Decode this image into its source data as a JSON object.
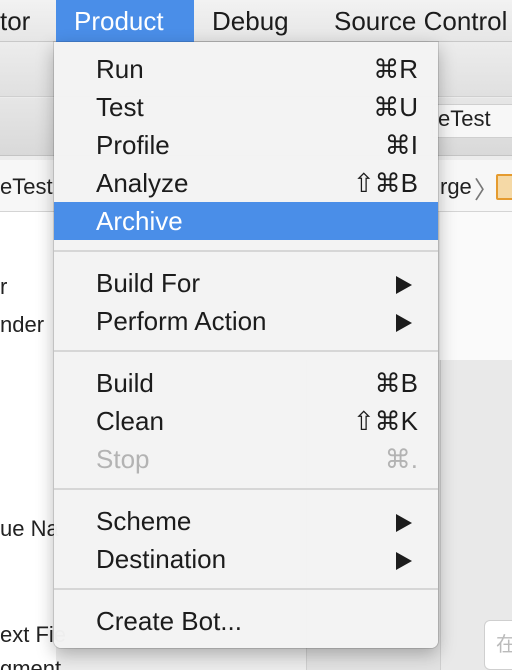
{
  "menubar": {
    "items": [
      {
        "label": "tor"
      },
      {
        "label": "Product"
      },
      {
        "label": "Debug"
      },
      {
        "label": "Source Control"
      }
    ]
  },
  "background": {
    "tab_right": "eTest",
    "jump_left": "eTest",
    "jump_right": "rge",
    "left_lines": [
      "r",
      "nder",
      "ue Na",
      "ext Fie",
      "gment"
    ],
    "right_box": "在"
  },
  "menu": {
    "items": [
      {
        "label": "Run",
        "shortcut": "⌘R"
      },
      {
        "label": "Test",
        "shortcut": "⌘U"
      },
      {
        "label": "Profile",
        "shortcut": "⌘I"
      },
      {
        "label": "Analyze",
        "shortcut": "⇧⌘B"
      },
      {
        "label": "Archive",
        "shortcut": ""
      },
      {
        "label": "Build For",
        "shortcut": ""
      },
      {
        "label": "Perform Action",
        "shortcut": ""
      },
      {
        "label": "Build",
        "shortcut": "⌘B"
      },
      {
        "label": "Clean",
        "shortcut": "⇧⌘K"
      },
      {
        "label": "Stop",
        "shortcut": "⌘."
      },
      {
        "label": "Scheme",
        "shortcut": ""
      },
      {
        "label": "Destination",
        "shortcut": ""
      },
      {
        "label": "Create Bot...",
        "shortcut": ""
      }
    ]
  }
}
